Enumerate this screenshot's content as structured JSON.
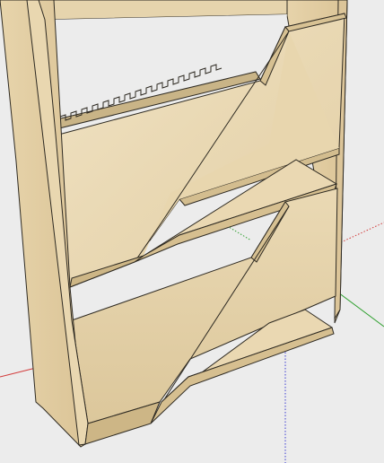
{
  "scene": {
    "subject": "plywood-shelf-unit-3d-model",
    "colors": {
      "background": "#ececec",
      "wood_light": "#eedfbf",
      "wood_mid": "#e4d2aa",
      "wood_dark": "#c9b487",
      "edge": "#2e2a22",
      "axis_red": "#d23a3a",
      "axis_green": "#2fa02f",
      "axis_blue": "#3a3ad2"
    }
  }
}
